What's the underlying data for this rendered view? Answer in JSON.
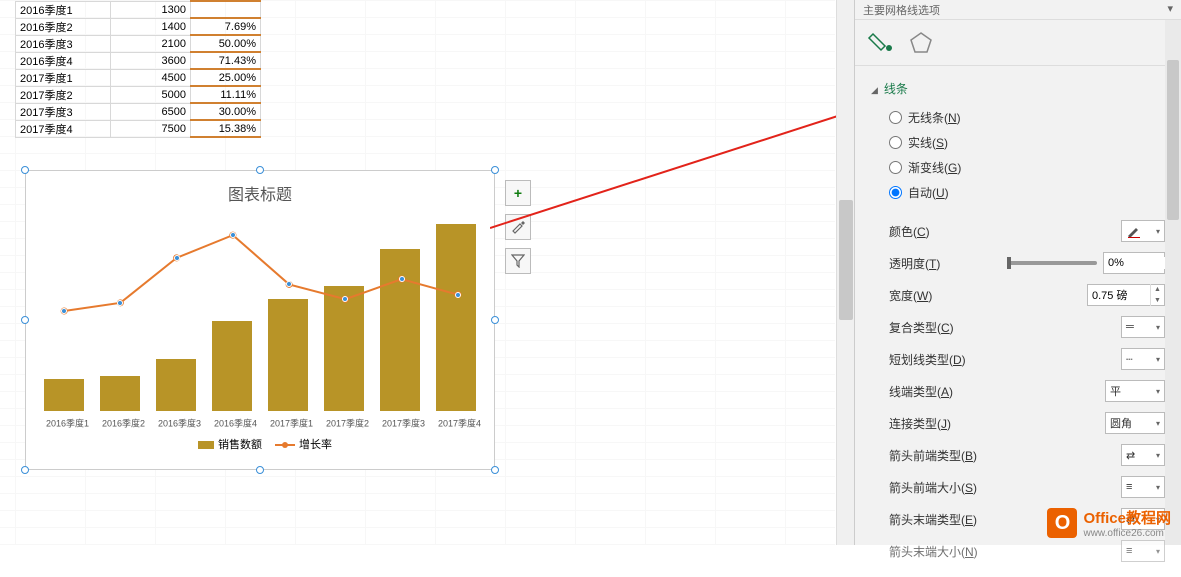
{
  "table": {
    "rows": [
      {
        "label": "2016季度1",
        "val": "1300",
        "pct": ""
      },
      {
        "label": "2016季度2",
        "val": "1400",
        "pct": "7.69%"
      },
      {
        "label": "2016季度3",
        "val": "2100",
        "pct": "50.00%"
      },
      {
        "label": "2016季度4",
        "val": "3600",
        "pct": "71.43%"
      },
      {
        "label": "2017季度1",
        "val": "4500",
        "pct": "25.00%"
      },
      {
        "label": "2017季度2",
        "val": "5000",
        "pct": "11.11%"
      },
      {
        "label": "2017季度3",
        "val": "6500",
        "pct": "30.00%"
      },
      {
        "label": "2017季度4",
        "val": "7500",
        "pct": "15.38%"
      }
    ]
  },
  "chart_data": {
    "type": "bar",
    "title": "图表标题",
    "categories": [
      "2016季度1",
      "2016季度2",
      "2016季度3",
      "2016季度4",
      "2017季度1",
      "2017季度2",
      "2017季度3",
      "2017季度4"
    ],
    "series": [
      {
        "name": "销售数额",
        "type": "bar",
        "color": "#b89427",
        "values": [
          1300,
          1400,
          2100,
          3600,
          4500,
          5000,
          6500,
          7500
        ]
      },
      {
        "name": "增长率",
        "type": "line",
        "color": "#e67a2e",
        "values": [
          0,
          7.69,
          50.0,
          71.43,
          25.0,
          11.11,
          30.0,
          15.38
        ]
      }
    ],
    "ylim_primary": [
      0,
      8000
    ],
    "ylim_secondary": [
      0,
      80
    ]
  },
  "legend": {
    "series1": "销售数额",
    "series2": "增长率"
  },
  "chart_buttons": {
    "plus": "+",
    "brush": "",
    "filter": ""
  },
  "pane": {
    "header": "主要网格线选项",
    "section": "线条",
    "radios": {
      "none": {
        "pre": "无线条(",
        "key": "N",
        "post": ")"
      },
      "solid": {
        "pre": "实线(",
        "key": "S",
        "post": ")"
      },
      "gradient": {
        "pre": "渐变线(",
        "key": "G",
        "post": ")"
      },
      "auto": {
        "pre": "自动(",
        "key": "U",
        "post": ")"
      }
    },
    "props": {
      "color": {
        "pre": "颜色(",
        "key": "C",
        "post": ")"
      },
      "transparency": {
        "pre": "透明度(",
        "key": "T",
        "post": ")",
        "value": "0%"
      },
      "width": {
        "pre": "宽度(",
        "key": "W",
        "post": ")",
        "value": "0.75 磅"
      },
      "compound": {
        "pre": "复合类型(",
        "key": "C",
        "post": ")"
      },
      "dash": {
        "pre": "短划线类型(",
        "key": "D",
        "post": ")"
      },
      "cap": {
        "pre": "线端类型(",
        "key": "A",
        "post": ")",
        "value": "平"
      },
      "join": {
        "pre": "连接类型(",
        "key": "J",
        "post": ")",
        "value": "圆角"
      },
      "arrowBeginType": {
        "pre": "箭头前端类型(",
        "key": "B",
        "post": ")"
      },
      "arrowBeginSize": {
        "pre": "箭头前端大小(",
        "key": "S",
        "post": ")"
      },
      "arrowEndType": {
        "pre": "箭头末端类型(",
        "key": "E",
        "post": ")"
      },
      "arrowEndSize": {
        "pre": "箭头末端大小(",
        "key": "N",
        "post": ")"
      }
    }
  },
  "watermark": {
    "brand": "Office教程网",
    "url": "www.office26.com",
    "logo": "O"
  }
}
